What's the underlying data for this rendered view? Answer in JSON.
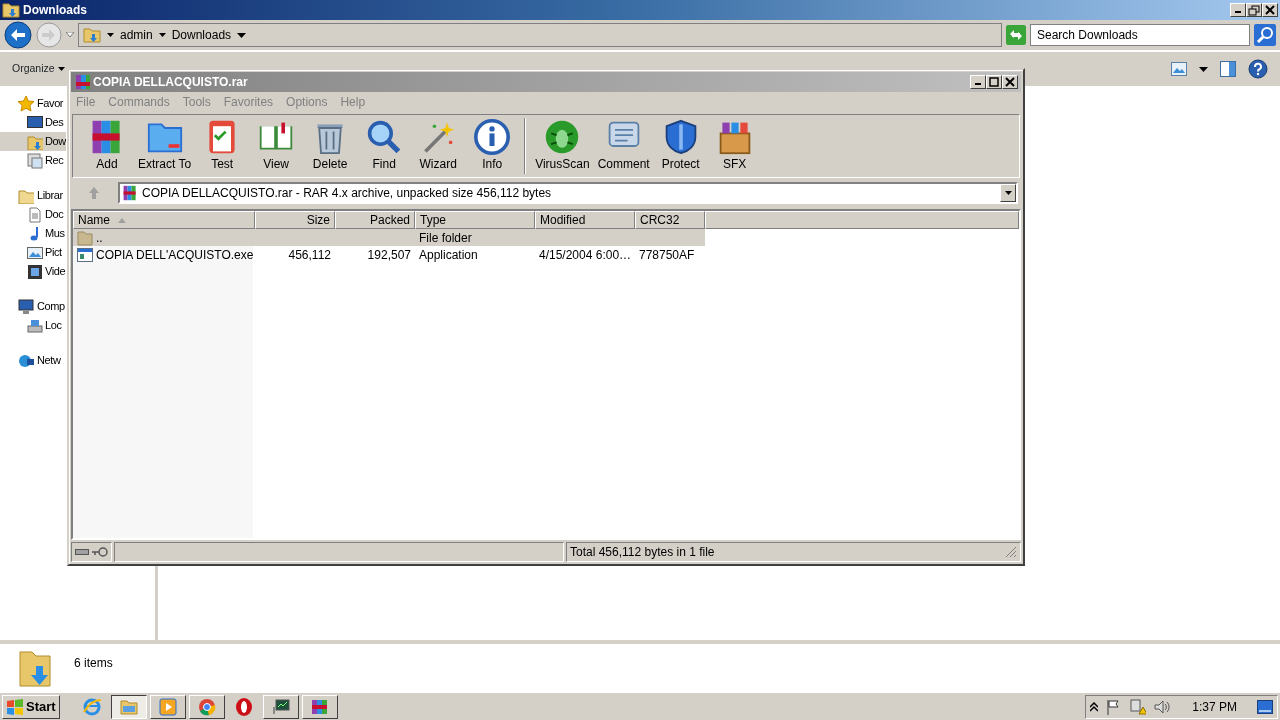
{
  "explorer": {
    "title": "Downloads",
    "breadcrumb": [
      "admin",
      "Downloads"
    ],
    "search": {
      "placeholder": "Search Downloads"
    },
    "organize": "Organize",
    "sidebar": [
      {
        "label": "Favor",
        "children": [
          {
            "label": "Des",
            "selected": false
          },
          {
            "label": "Dow",
            "selected": true
          },
          {
            "label": "Rec",
            "selected": false
          }
        ]
      },
      {
        "label": "Librar",
        "children": [
          {
            "label": "Doc",
            "selected": false
          },
          {
            "label": "Mus",
            "selected": false
          },
          {
            "label": "Pict",
            "selected": false
          },
          {
            "label": "Vide",
            "selected": false
          }
        ]
      },
      {
        "label": "Comp",
        "children": [
          {
            "label": "Loc",
            "selected": false
          }
        ]
      },
      {
        "label": "Netw"
      }
    ],
    "details": {
      "count": "6 items"
    }
  },
  "winrar": {
    "title": "COPIA DELLACQUISTO.rar",
    "menu": [
      "File",
      "Commands",
      "Tools",
      "Favorites",
      "Options",
      "Help"
    ],
    "toolbar_groups": [
      {
        "buttons": [
          {
            "label": "Add"
          },
          {
            "label": "Extract To"
          },
          {
            "label": "Test"
          },
          {
            "label": "View"
          },
          {
            "label": "Delete"
          },
          {
            "label": "Find"
          },
          {
            "label": "Wizard"
          },
          {
            "label": "Info"
          }
        ]
      },
      {
        "buttons": [
          {
            "label": "VirusScan"
          },
          {
            "label": "Comment"
          },
          {
            "label": "Protect"
          },
          {
            "label": "SFX"
          }
        ]
      }
    ],
    "path": "COPIA DELLACQUISTO.rar - RAR 4.x archive, unpacked size 456,112 bytes",
    "columns": [
      {
        "label": "Name",
        "sorted": true
      },
      {
        "label": "Size"
      },
      {
        "label": "Packed"
      },
      {
        "label": "Type"
      },
      {
        "label": "Modified"
      },
      {
        "label": "CRC32"
      }
    ],
    "rows": [
      {
        "kind": "folder",
        "selected": true,
        "cells": [
          "..",
          "",
          "",
          "File folder",
          "",
          ""
        ]
      },
      {
        "kind": "file",
        "selected": false,
        "cells": [
          "COPIA DELL'ACQUISTO.exe",
          "456,112",
          "192,507",
          "Application",
          "4/15/2004 6:00…",
          "778750AF"
        ]
      }
    ],
    "status": "Total 456,112 bytes in 1 file"
  },
  "taskbar": {
    "start": "Start",
    "items": [
      {
        "running": false
      },
      {
        "running": true,
        "selected": true
      },
      {
        "running": true,
        "selected": false
      },
      {
        "running": true,
        "selected": false
      },
      {
        "running": false
      },
      {
        "running": true,
        "selected": false
      },
      {
        "running": true,
        "selected": false
      }
    ],
    "clock": "1:37 PM"
  }
}
